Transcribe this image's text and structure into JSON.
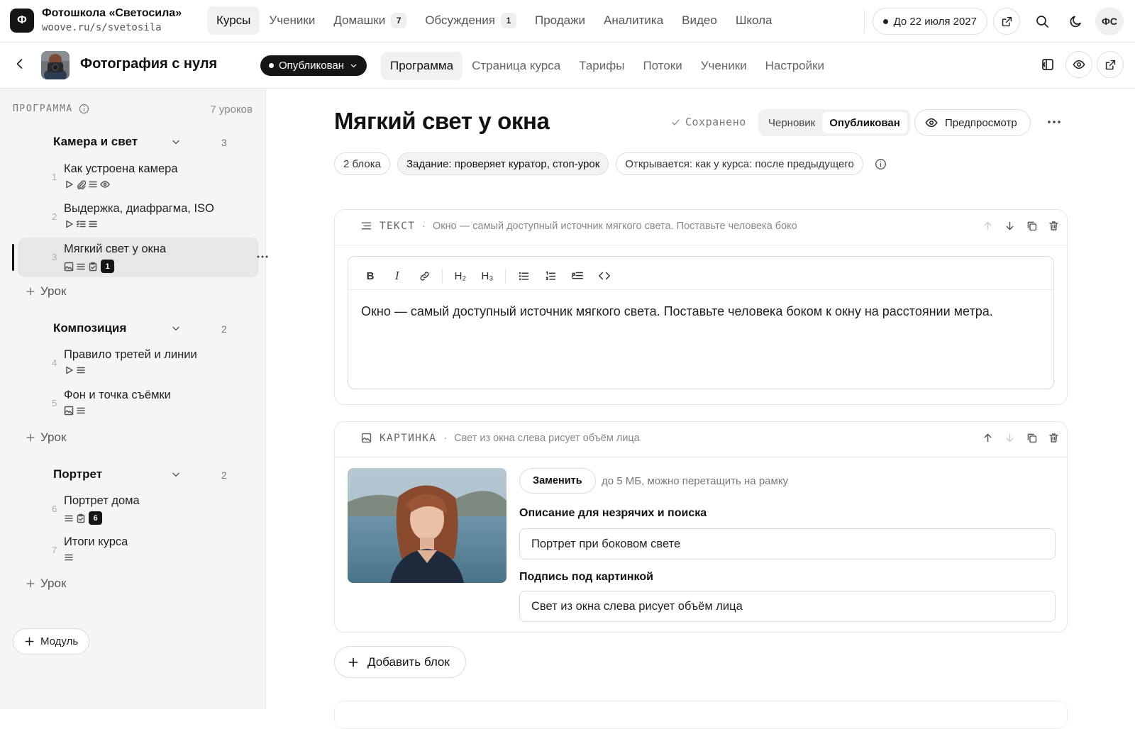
{
  "app": {
    "logo_letter": "Ф",
    "school_name": "Фотошкола «Светосила»",
    "school_url": "woove.ru/s/svetosila"
  },
  "nav": {
    "items": [
      {
        "label": "Курсы",
        "count": "",
        "active": true
      },
      {
        "label": "Ученики",
        "count": ""
      },
      {
        "label": "Домашки",
        "count": "7"
      },
      {
        "label": "Обсуждения",
        "count": "1"
      },
      {
        "label": "Продажи",
        "count": ""
      },
      {
        "label": "Аналитика",
        "count": ""
      },
      {
        "label": "Видео",
        "count": ""
      },
      {
        "label": "Школа",
        "count": ""
      }
    ]
  },
  "topright": {
    "subscription": "До 22 июля 2027",
    "avatar_initials": "ФС"
  },
  "course": {
    "title": "Фотография с нуля",
    "status": "Опубликован",
    "tabs": [
      {
        "label": "Программа",
        "active": true
      },
      {
        "label": "Страница курса"
      },
      {
        "label": "Тарифы"
      },
      {
        "label": "Потоки"
      },
      {
        "label": "Ученики"
      },
      {
        "label": "Настройки"
      }
    ]
  },
  "sidebar": {
    "heading": "ПРОГРАММА",
    "lessons_count": "7 уроков",
    "add_lesson": "Урок",
    "add_module": "Модуль",
    "modules": [
      {
        "title": "Камера и свет",
        "count": "3",
        "lessons": [
          {
            "num": "1",
            "name": "Как устроена камера",
            "icons": [
              "play",
              "clip",
              "text",
              "eye"
            ]
          },
          {
            "num": "2",
            "name": "Выдержка, диафрагма, ISO",
            "icons": [
              "play",
              "quiz",
              "text"
            ]
          },
          {
            "num": "3",
            "name": "Мягкий свет у окна",
            "icons": [
              "image",
              "text",
              "task"
            ],
            "badge": "1",
            "active": true
          }
        ]
      },
      {
        "title": "Композиция",
        "count": "2",
        "lessons": [
          {
            "num": "4",
            "name": "Правило третей и линии",
            "icons": [
              "play",
              "text"
            ]
          },
          {
            "num": "5",
            "name": "Фон и точка съёмки",
            "icons": [
              "image",
              "text"
            ]
          }
        ]
      },
      {
        "title": "Портрет",
        "count": "2",
        "lessons": [
          {
            "num": "6",
            "name": "Портрет дома",
            "icons": [
              "text",
              "task"
            ],
            "badge": "6"
          },
          {
            "num": "7",
            "name": "Итоги курса",
            "icons": [
              "text"
            ]
          }
        ]
      }
    ]
  },
  "lesson": {
    "title": "Мягкий свет у окна",
    "saved_label": "Сохранено",
    "segment": {
      "draft": "Черновик",
      "published": "Опубликован"
    },
    "preview_label": "Предпросмотр",
    "chips": [
      "2 блока",
      "Задание: проверяет куратор, стоп-урок",
      "Открывается: как у курса: после предыдущего"
    ]
  },
  "blocks": {
    "text_block": {
      "type_label": "ТЕКСТ",
      "summary": "Окно — самый доступный источник мягкого света. Поставьте человека боко",
      "content": "Окно — самый доступный источник мягкого света. Поставьте человека боком к окну на расстоянии метра.",
      "toolbar": {
        "bold": "B",
        "italic": "I",
        "h2": "H₂",
        "h3": "H₃"
      }
    },
    "image_block": {
      "type_label": "КАРТИНКА",
      "summary": "Свет из окна слева рисует объём лица",
      "replace_label": "Заменить",
      "hint": "до 5 МБ, можно перетащить на рамку",
      "alt_label": "Описание для незрячих и поиска",
      "alt_value": "Портрет при боковом свете",
      "caption_label": "Подпись под картинкой",
      "caption_value": "Свет из окна слева рисует объём лица"
    },
    "add_block": "Добавить блок"
  },
  "colors": {
    "accent": "#151515",
    "sidebar_bg": "#f5f5f5",
    "active_lesson_bg": "#e7e7e7"
  }
}
